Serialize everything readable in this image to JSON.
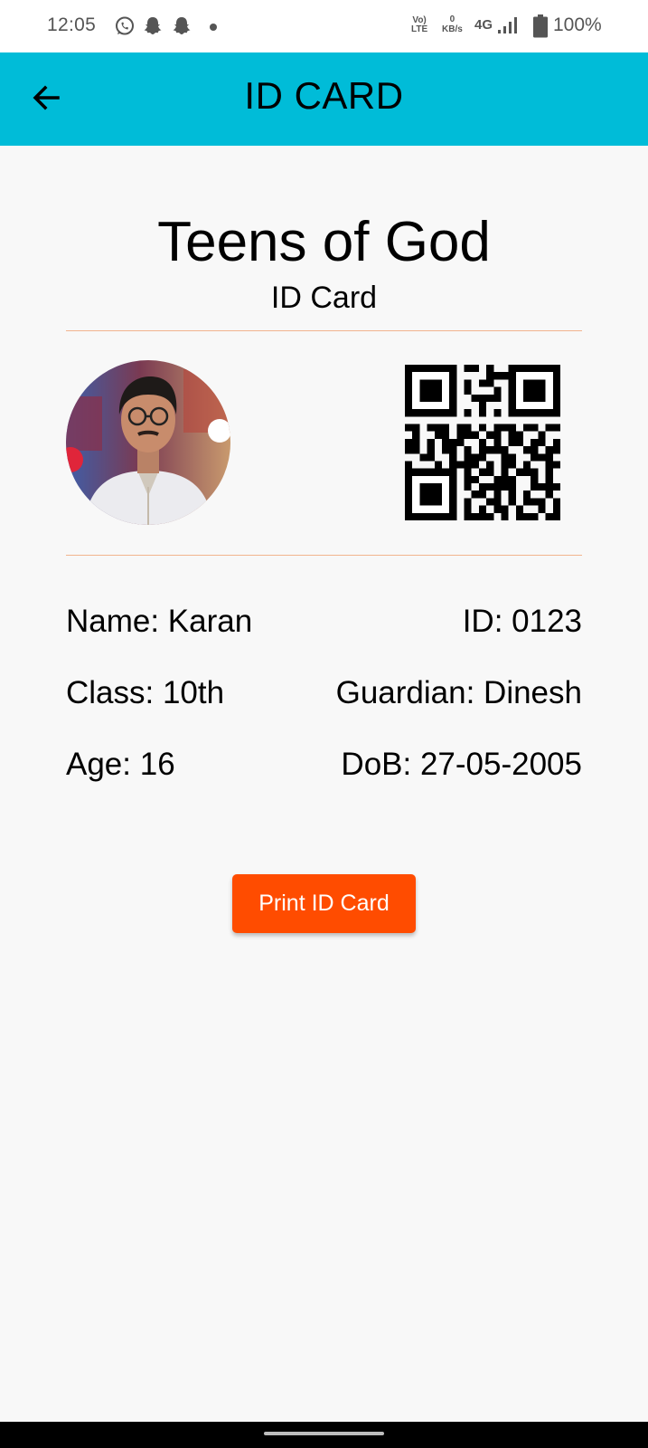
{
  "status_bar": {
    "time": "12:05",
    "notification_icons": [
      "whatsapp-icon",
      "snapchat-icon",
      "snapchat-icon",
      "dot-icon"
    ],
    "volte_line1": "Vo)",
    "volte_line2": "LTE",
    "data_speed_value": "0",
    "data_speed_unit": "KB/s",
    "network": "4G",
    "battery_percent": "100%"
  },
  "app_bar": {
    "back_icon": "arrow-left-icon",
    "title": "ID CARD",
    "color": "#00bcd8"
  },
  "card": {
    "org_name": "Teens of God",
    "subtitle": "ID Card",
    "photo": "profile-photo",
    "qr": "qr-code",
    "fields": [
      {
        "left": "Name: Karan",
        "right": "ID: 0123"
      },
      {
        "left": "Class: 10th",
        "right": "Guardian: Dinesh"
      },
      {
        "left": "Age: 16",
        "right": "DoB: 27-05-2005"
      }
    ]
  },
  "actions": {
    "print_label": "Print ID Card",
    "print_color": "#ff4c00"
  }
}
